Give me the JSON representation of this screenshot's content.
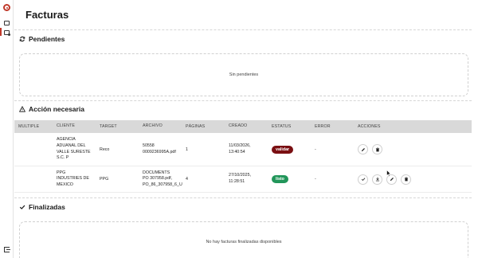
{
  "page": {
    "title": "Facturas"
  },
  "sections": {
    "pending": {
      "title": "Pendientes",
      "empty": "Sin pendientes"
    },
    "action": {
      "title": "Acción necesaria"
    },
    "done": {
      "title": "Finalizadas",
      "empty": "No hay facturas finalizadas disponibles"
    }
  },
  "table": {
    "headers": {
      "multiple": "MULTIPLE",
      "client": "CLIENTE",
      "target": "TARGET",
      "file": "ARCHIVO",
      "pages": "PÁGINAS",
      "created": "CREADO",
      "status": "ESTATUS",
      "error": "ERROR",
      "actions": "ACCIONES"
    },
    "rows": [
      {
        "multiple": "",
        "client": [
          "AGENCIA",
          "ADUANAL DEL",
          "VALLE SURESTE",
          "S.C. P"
        ],
        "target": "Reco",
        "file": [
          "50558",
          "0009236995A.pdf"
        ],
        "pages": "1",
        "created": [
          "11/03/2026,",
          "13:40:54"
        ],
        "status": "validar",
        "status_color": "#7a0f12",
        "error": "-",
        "actions": [
          "edit-icon",
          "trash-icon"
        ]
      },
      {
        "multiple": "",
        "client": [
          "PPG",
          "INDUSTRIES DE",
          "MEXICO"
        ],
        "target": "PPG",
        "file": [
          "DOCUMENTS",
          "PO 307958.pdf,",
          "PO_86_307958_6_U"
        ],
        "pages": "4",
        "created": [
          "27/10/2025,",
          "11:28:51"
        ],
        "status": "listo",
        "status_color": "#22965a",
        "error": "-",
        "actions": [
          "check-icon",
          "download-icon",
          "edit-icon",
          "trash-icon"
        ]
      }
    ]
  }
}
